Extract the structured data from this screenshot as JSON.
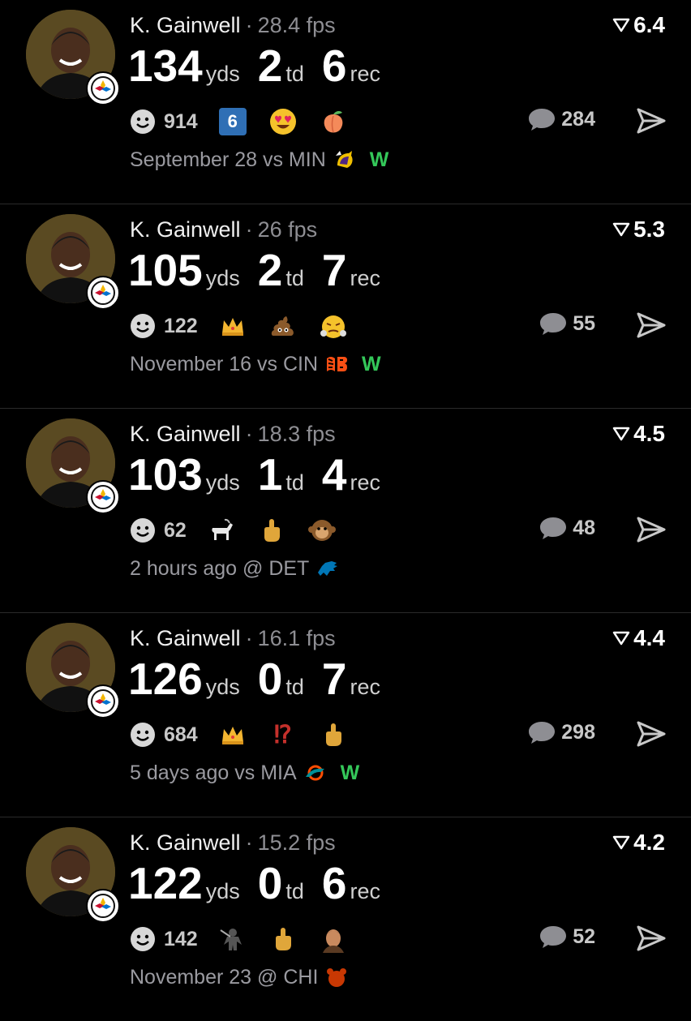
{
  "posts": [
    {
      "name": "K. Gainwell",
      "fps": "28.4 fps",
      "rank": "6.4",
      "yds": "134",
      "yds_unit": "yds",
      "td": "2",
      "td_unit": "td",
      "rec": "6",
      "rec_unit": "rec",
      "reaction_count": "914",
      "reactions": [
        "six-badge",
        "heart-eyes",
        "peach"
      ],
      "six_label": "6",
      "comments": "284",
      "game": "September 28 vs MIN",
      "team": "vikings-logo",
      "result": "W"
    },
    {
      "name": "K. Gainwell",
      "fps": "26 fps",
      "rank": "5.3",
      "yds": "105",
      "yds_unit": "yds",
      "td": "2",
      "td_unit": "td",
      "rec": "7",
      "rec_unit": "rec",
      "reaction_count": "122",
      "reactions": [
        "crown",
        "poop",
        "steam-face"
      ],
      "comments": "55",
      "game": "November 16 vs CIN",
      "team": "bengals-logo",
      "result": "W"
    },
    {
      "name": "K. Gainwell",
      "fps": "18.3 fps",
      "rank": "4.5",
      "yds": "103",
      "yds_unit": "yds",
      "td": "1",
      "td_unit": "td",
      "rec": "4",
      "rec_unit": "rec",
      "reaction_count": "62",
      "reactions": [
        "goat",
        "middle-finger",
        "monkey"
      ],
      "comments": "48",
      "game": "2 hours ago @ DET",
      "team": "lions-logo",
      "result": ""
    },
    {
      "name": "K. Gainwell",
      "fps": "16.1 fps",
      "rank": "4.4",
      "yds": "126",
      "yds_unit": "yds",
      "td": "0",
      "td_unit": "td",
      "rec": "7",
      "rec_unit": "rec",
      "reaction_count": "684",
      "reactions": [
        "crown",
        "interrobang",
        "middle-finger"
      ],
      "interrobang_label": "⁉",
      "comments": "298",
      "game": "5 days ago vs MIA",
      "team": "dolphins-logo",
      "result": "W"
    },
    {
      "name": "K. Gainwell",
      "fps": "15.2 fps",
      "rank": "4.2",
      "yds": "122",
      "yds_unit": "yds",
      "td": "0",
      "td_unit": "td",
      "rec": "6",
      "rec_unit": "rec",
      "reaction_count": "142",
      "reactions": [
        "ninja",
        "middle-finger",
        "person-face"
      ],
      "comments": "52",
      "game": "November 23 @ CHI",
      "team": "bears-logo",
      "result": ""
    }
  ],
  "separator": "·",
  "colors": {
    "background": "#000000",
    "win": "#34c759",
    "muted": "#8e8e93",
    "avatar_bg": "#5a4a22"
  }
}
